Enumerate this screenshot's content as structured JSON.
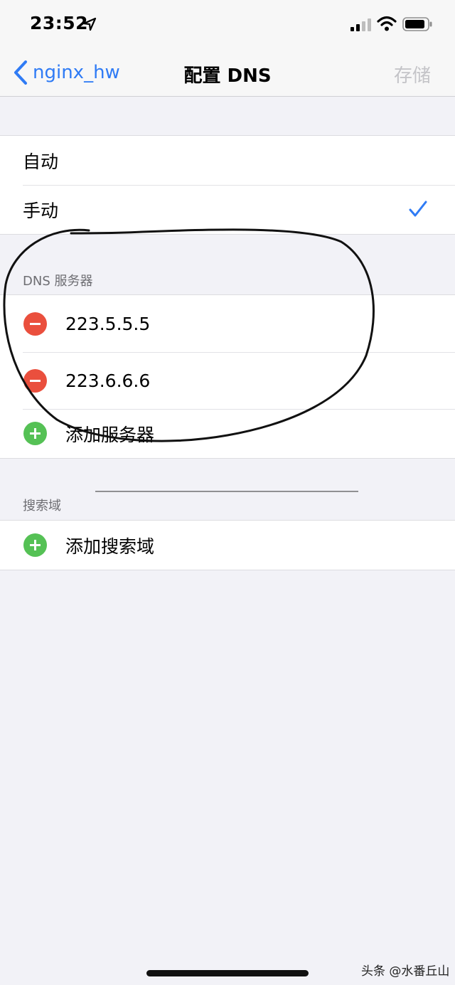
{
  "status_bar": {
    "time": "23:52",
    "icons": [
      "location-arrow-icon",
      "signal-icon",
      "wifi-icon",
      "battery-icon"
    ]
  },
  "nav": {
    "back_label": "nginx_hw",
    "title": "配置 DNS",
    "save_label": "存储"
  },
  "mode": {
    "options": [
      {
        "label": "自动",
        "selected": false
      },
      {
        "label": "手动",
        "selected": true
      }
    ]
  },
  "dns": {
    "header": "DNS 服务器",
    "servers": [
      "223.5.5.5",
      "223.6.6.6"
    ],
    "add_label": "添加服务器"
  },
  "search_domains": {
    "header": "搜索域",
    "add_label": "添加搜索域"
  },
  "watermark": "头条 @水番丘山",
  "colors": {
    "accent": "#2f7bf5",
    "delete": "#ea4f3d",
    "add": "#55c155",
    "background": "#f2f2f7",
    "disabled": "#c4c4c8"
  }
}
